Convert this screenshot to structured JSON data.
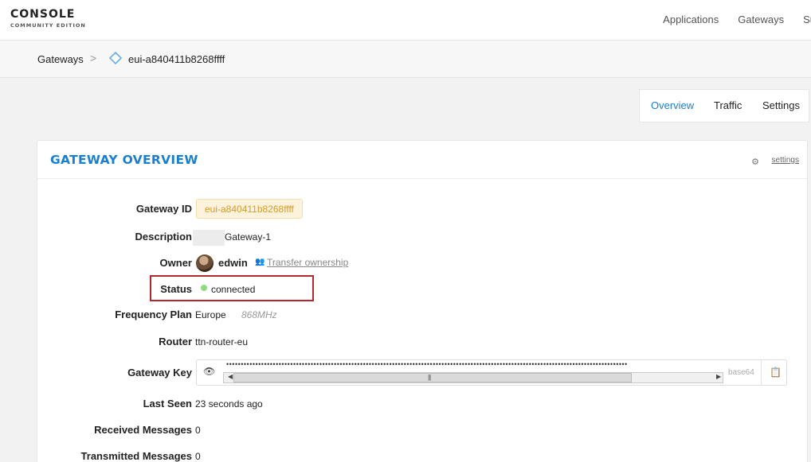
{
  "brand": {
    "name": "CONSOLE",
    "edition": "COMMUNITY EDITION"
  },
  "nav": {
    "items": [
      "Applications",
      "Gateways",
      "Su"
    ]
  },
  "breadcrumb": {
    "root": "Gateways",
    "separator": ">",
    "current": "eui-a840411b8268ffff"
  },
  "tabs": [
    {
      "label": "Overview",
      "active": true
    },
    {
      "label": "Traffic",
      "active": false
    },
    {
      "label": "Settings",
      "active": false
    }
  ],
  "overview": {
    "title": "GATEWAY OVERVIEW",
    "settings_link": "settings",
    "fields": {
      "gateway_id": {
        "label": "Gateway ID",
        "value": "eui-a840411b8268ffff"
      },
      "description": {
        "label": "Description",
        "value": "Gateway-1"
      },
      "owner": {
        "label": "Owner",
        "value": "edwin",
        "transfer": "Transfer ownership"
      },
      "status": {
        "label": "Status",
        "value": "connected",
        "color": "#8fdc7e"
      },
      "frequency_plan": {
        "label": "Frequency Plan",
        "value": "Europe",
        "band": "868MHz"
      },
      "router": {
        "label": "Router",
        "value": "ttn-router-eu"
      },
      "gateway_key": {
        "label": "Gateway Key",
        "encoding": "base64",
        "masked": "••••••••••••••••••••••••••••••••••••••••••••••••••••••••••••••••••••••••••••••••••••••••••••••••••••••••••••••••••••••••••••••••••••••••••"
      },
      "last_seen": {
        "label": "Last Seen",
        "value": "23 seconds ago"
      },
      "received_messages": {
        "label": "Received Messages",
        "value": "0"
      },
      "transmitted_messages": {
        "label": "Transmitted Messages",
        "value": "0"
      }
    }
  },
  "colors": {
    "accent": "#1a7fd0",
    "highlight_border": "#b3282d",
    "id_badge_text": "#d59a2c"
  },
  "icons": [
    "gateway-icon",
    "gear-icon",
    "user-transfer-icon",
    "eye-icon",
    "copy-icon"
  ]
}
